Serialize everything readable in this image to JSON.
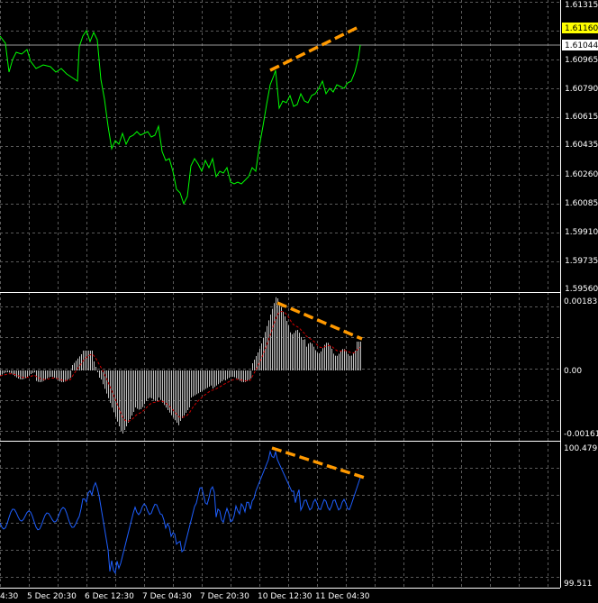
{
  "price_pane": {
    "ticks": [
      "1.61315",
      "1.60965",
      "1.60790",
      "1.60615",
      "1.60435",
      "1.60260",
      "1.60085",
      "1.59910",
      "1.59735",
      "1.59560"
    ],
    "tag_yellow": "1.61160",
    "tag_white": "1.61044",
    "color": "#00ff00",
    "trend_color": "#ff9900"
  },
  "macd_pane": {
    "ticks": [
      "0.001831",
      "0.00",
      "-0.00161"
    ],
    "histogram_color": "#c0c0c0",
    "signal_color": "#cc0000",
    "trend_color": "#ff9900"
  },
  "cci_pane": {
    "ticks": [
      "100.4791",
      "99.511"
    ],
    "color": "#1e5fff",
    "trend_color": "#ff9900"
  },
  "time_axis": [
    "4:30",
    "5 Dec 20:30",
    "6 Dec 12:30",
    "7 Dec 04:30",
    "7 Dec 20:30",
    "10 Dec 12:30",
    "11 Dec 04:30"
  ],
  "colors": {
    "background": "#000000",
    "grid": "#5a5a5a",
    "separator": "#ffffff",
    "tag_yellow_bg": "#ffff00"
  }
}
